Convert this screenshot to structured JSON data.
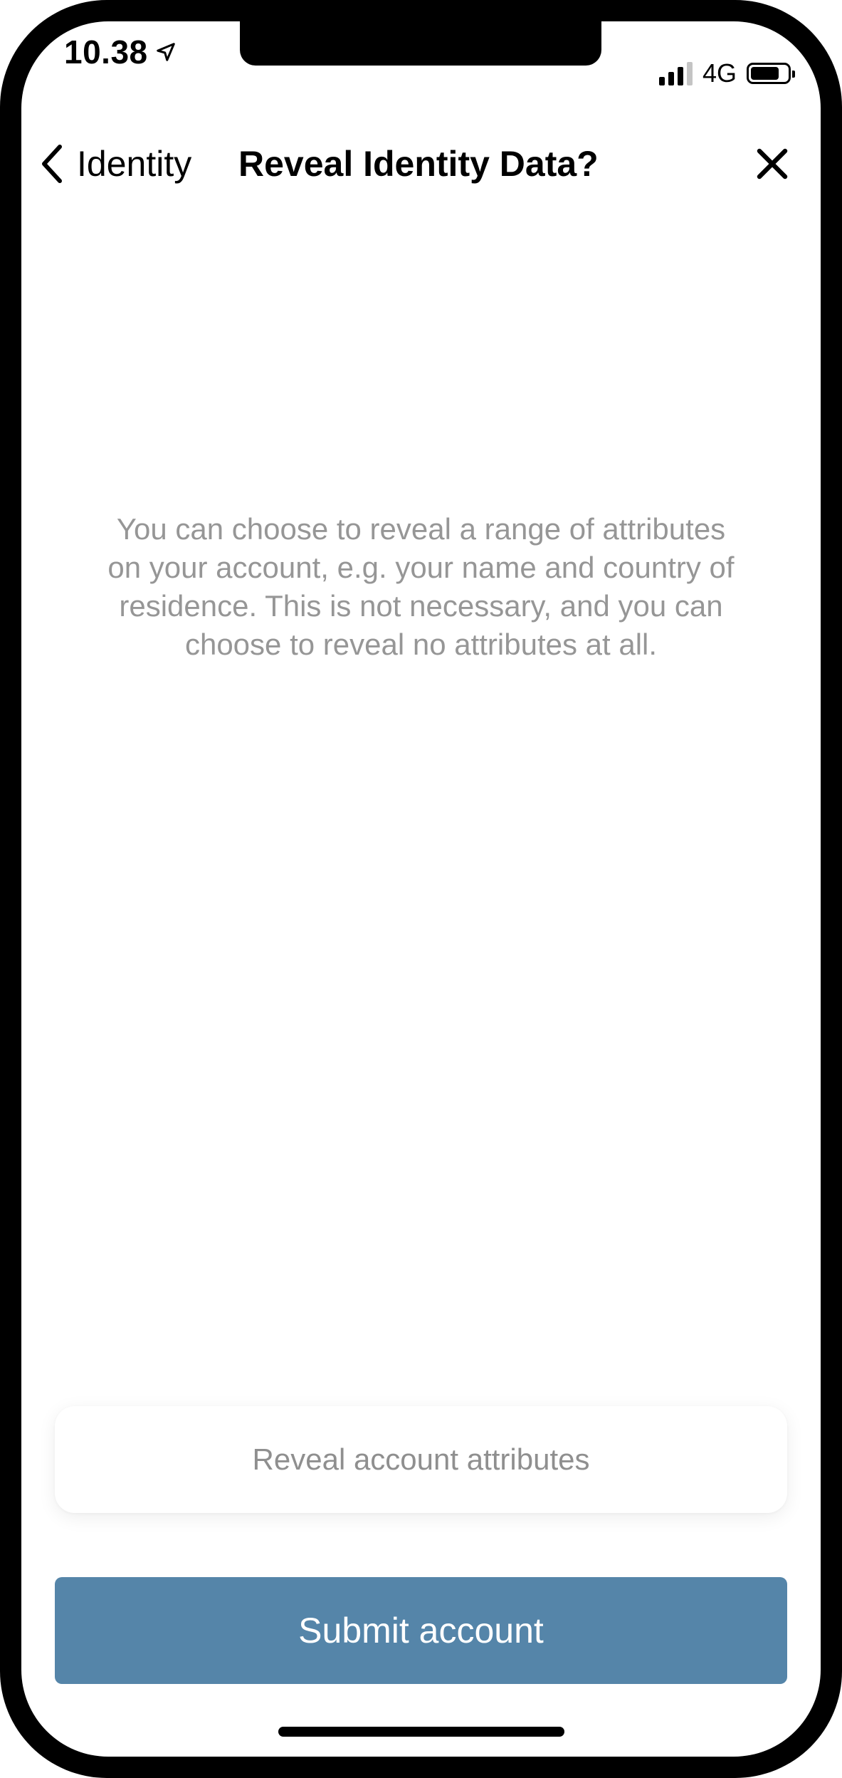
{
  "status_bar": {
    "time": "10.38",
    "network": "4G",
    "signal_bars_active": 3,
    "signal_bars_total": 4,
    "battery_level": 0.8,
    "icons": [
      "location-arrow-icon",
      "signal-icon",
      "battery-icon"
    ]
  },
  "nav": {
    "back_label": "Identity",
    "title": "Reveal Identity Data?",
    "back_icon": "chevron-left-icon",
    "close_icon": "close-icon"
  },
  "main": {
    "description": "You can choose to reveal a range of attributes on your account, e.g. your name and country of residence. This is not necessary, and you can choose to reveal no attributes at all.",
    "reveal_label": "Reveal account attributes"
  },
  "footer": {
    "submit_label": "Submit account"
  },
  "colors": {
    "accent": "#5585A9",
    "secondary_text": "#969696",
    "background": "#FFFFFF"
  }
}
